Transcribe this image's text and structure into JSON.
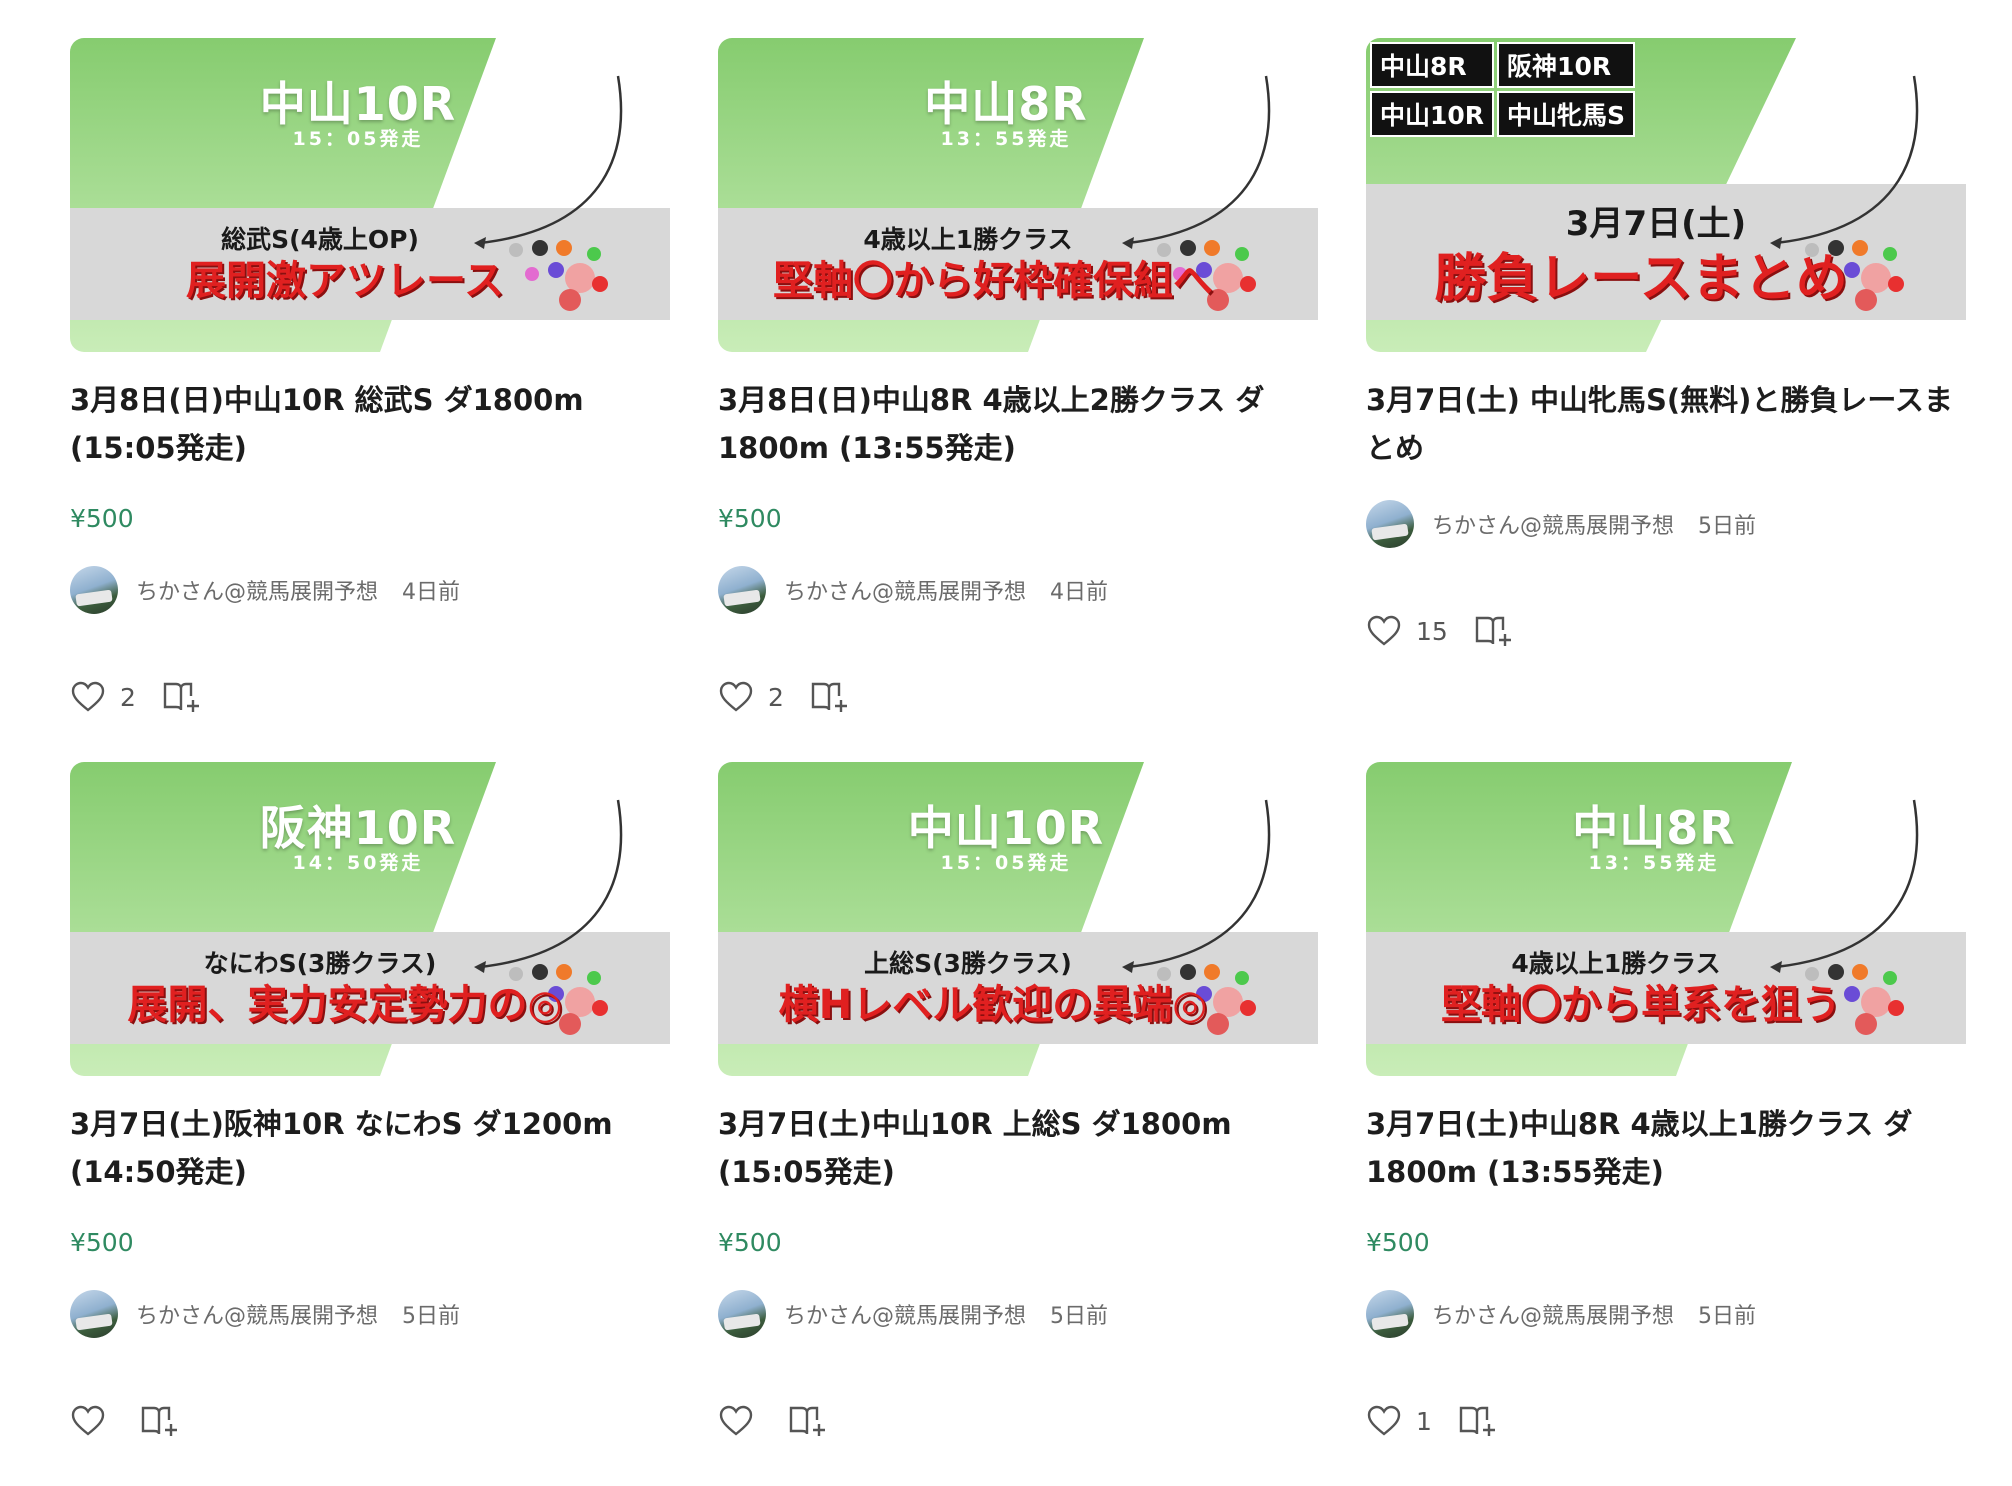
{
  "cards": [
    {
      "thumb": {
        "big": "中山10R",
        "time": "15：05発走",
        "sub": "総武S(4歳上OP)",
        "headline": "展開激アツレース"
      },
      "title": "3月8日(日)中山10R 総武S ダ1800m (15:05発走)",
      "price": "¥500",
      "author": "ちかさん@競馬展開予想",
      "date": "4日前",
      "likes": "2"
    },
    {
      "thumb": {
        "big": "中山8R",
        "time": "13：55発走",
        "sub": "4歳以上1勝クラス",
        "headline": "堅軸〇から好枠確保組へ"
      },
      "title": "3月8日(日)中山8R 4歳以上2勝クラス ダ1800m (13:55発走)",
      "price": "¥500",
      "author": "ちかさん@競馬展開予想",
      "date": "4日前",
      "likes": "2"
    },
    {
      "thumb": {
        "tags": [
          "中山8R",
          "阪神10R",
          "中山10R",
          "中山牝馬S"
        ],
        "subdate": "3月7日(土)",
        "headline": "勝負レースまとめ"
      },
      "title": "3月7日(土) 中山牝馬S(無料)と勝負レースまとめ",
      "author": "ちかさん@競馬展開予想",
      "date": "5日前",
      "likes": "15"
    },
    {
      "thumb": {
        "big": "阪神10R",
        "time": "14：50発走",
        "sub": "なにわS(3勝クラス)",
        "headline": "展開、実力安定勢力の◎"
      },
      "title": "3月7日(土)阪神10R なにわS ダ1200m (14:50発走)",
      "price": "¥500",
      "author": "ちかさん@競馬展開予想",
      "date": "5日前",
      "likes": ""
    },
    {
      "thumb": {
        "big": "中山10R",
        "time": "15：05発走",
        "sub": "上総S(3勝クラス)",
        "headline": "横Hレベル歓迎の異端◎"
      },
      "title": "3月7日(土)中山10R 上総S ダ1800m (15:05発走)",
      "price": "¥500",
      "author": "ちかさん@競馬展開予想",
      "date": "5日前",
      "likes": ""
    },
    {
      "thumb": {
        "big": "中山8R",
        "time": "13：55発走",
        "sub": "4歳以上1勝クラス",
        "headline": "堅軸〇から単系を狙う"
      },
      "title": "3月7日(土)中山8R 4歳以上1勝クラス ダ1800m (13:55発走)",
      "price": "¥500",
      "author": "ちかさん@競馬展開予想",
      "date": "5日前",
      "likes": "1"
    }
  ],
  "colors": {
    "accent_price": "#2f8a61",
    "banner_green": "#8fd47a",
    "headline_red": "#e02020"
  },
  "icons": {
    "like": "heart-icon",
    "save": "bookmark-add-icon"
  }
}
